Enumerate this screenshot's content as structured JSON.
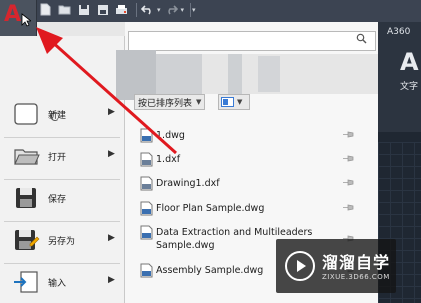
{
  "titlebar": {
    "tab_label": "A360",
    "ribbon_big_letter": "A",
    "ribbon_text_label": "文字"
  },
  "app_menu": {
    "items": [
      {
        "label": "新建",
        "icon": "new-document-icon"
      },
      {
        "label": "打开",
        "icon": "open-folder-icon"
      },
      {
        "label": "保存",
        "icon": "save-disk-icon"
      },
      {
        "label": "另存为",
        "icon": "save-as-icon"
      },
      {
        "label": "输入",
        "icon": "import-icon"
      }
    ],
    "blurred_letter": "C"
  },
  "search": {
    "placeholder": ""
  },
  "sort": {
    "label": "按已排序列表"
  },
  "recent_files": [
    {
      "name": "1.dwg",
      "icon": "dwg-file-icon"
    },
    {
      "name": "1.dxf",
      "icon": "dxf-file-icon"
    },
    {
      "name": "Drawing1.dxf",
      "icon": "dxf-file-icon"
    },
    {
      "name": "Floor Plan Sample.dwg",
      "icon": "dwg-file-icon"
    },
    {
      "name": "Data Extraction and Multileaders Sample.dwg",
      "icon": "dwg-file-icon"
    },
    {
      "name": "Assembly Sample.dwg",
      "icon": "dwg-file-icon"
    }
  ],
  "watermark": {
    "title": "溜溜自学",
    "url": "ZIXUE.3D66.COM"
  },
  "colors": {
    "app_logo_red": "#d6262e",
    "annotation_arrow": "#e0191f",
    "titlebar_bg": "#3c4452"
  }
}
